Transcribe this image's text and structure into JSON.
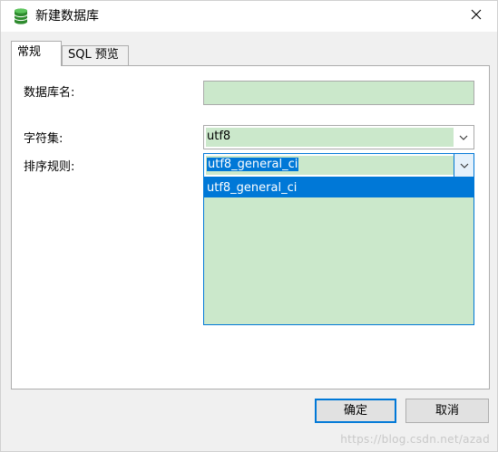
{
  "window": {
    "title": "新建数据库",
    "icon": "database-icon",
    "close_icon": "close-icon"
  },
  "tabs": [
    {
      "label": "常规",
      "active": true
    },
    {
      "label": "SQL 预览",
      "active": false
    }
  ],
  "form": {
    "db_name_label": "数据库名:",
    "db_name_value": "",
    "charset_label": "字符集:",
    "charset_value": "utf8",
    "collation_label": "排序规则:",
    "collation_value": "utf8_general_ci",
    "collation_options": [
      "utf8_general_ci"
    ]
  },
  "buttons": {
    "ok": "确定",
    "cancel": "取消"
  },
  "watermark": "https://blog.csdn.net/azad",
  "colors": {
    "field_bg": "#cbe8cb",
    "accent": "#0078d7"
  }
}
